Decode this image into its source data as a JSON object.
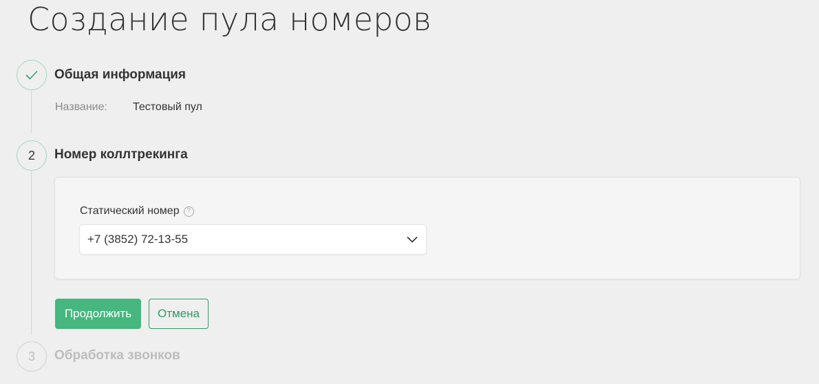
{
  "page": {
    "title": "Создание пула номеров"
  },
  "steps": [
    {
      "number": "",
      "title": "Общая информация",
      "state": "done",
      "icon": "checkmark-icon"
    },
    {
      "number": "2",
      "title": "Номер коллтрекинга",
      "state": "active"
    },
    {
      "number": "3",
      "title": "Обработка звонков",
      "state": "pending"
    }
  ],
  "summary": {
    "label": "Название:",
    "value": "Тестовый пул"
  },
  "form": {
    "field_label": "Статический номер",
    "help_icon": "?",
    "selected_value": "+7 (3852) 72-13-55"
  },
  "actions": {
    "continue_label": "Продолжить",
    "cancel_label": "Отмена"
  },
  "colors": {
    "accent": "#45b77f",
    "accent_dark": "#2f9a63",
    "background": "#efefef"
  }
}
